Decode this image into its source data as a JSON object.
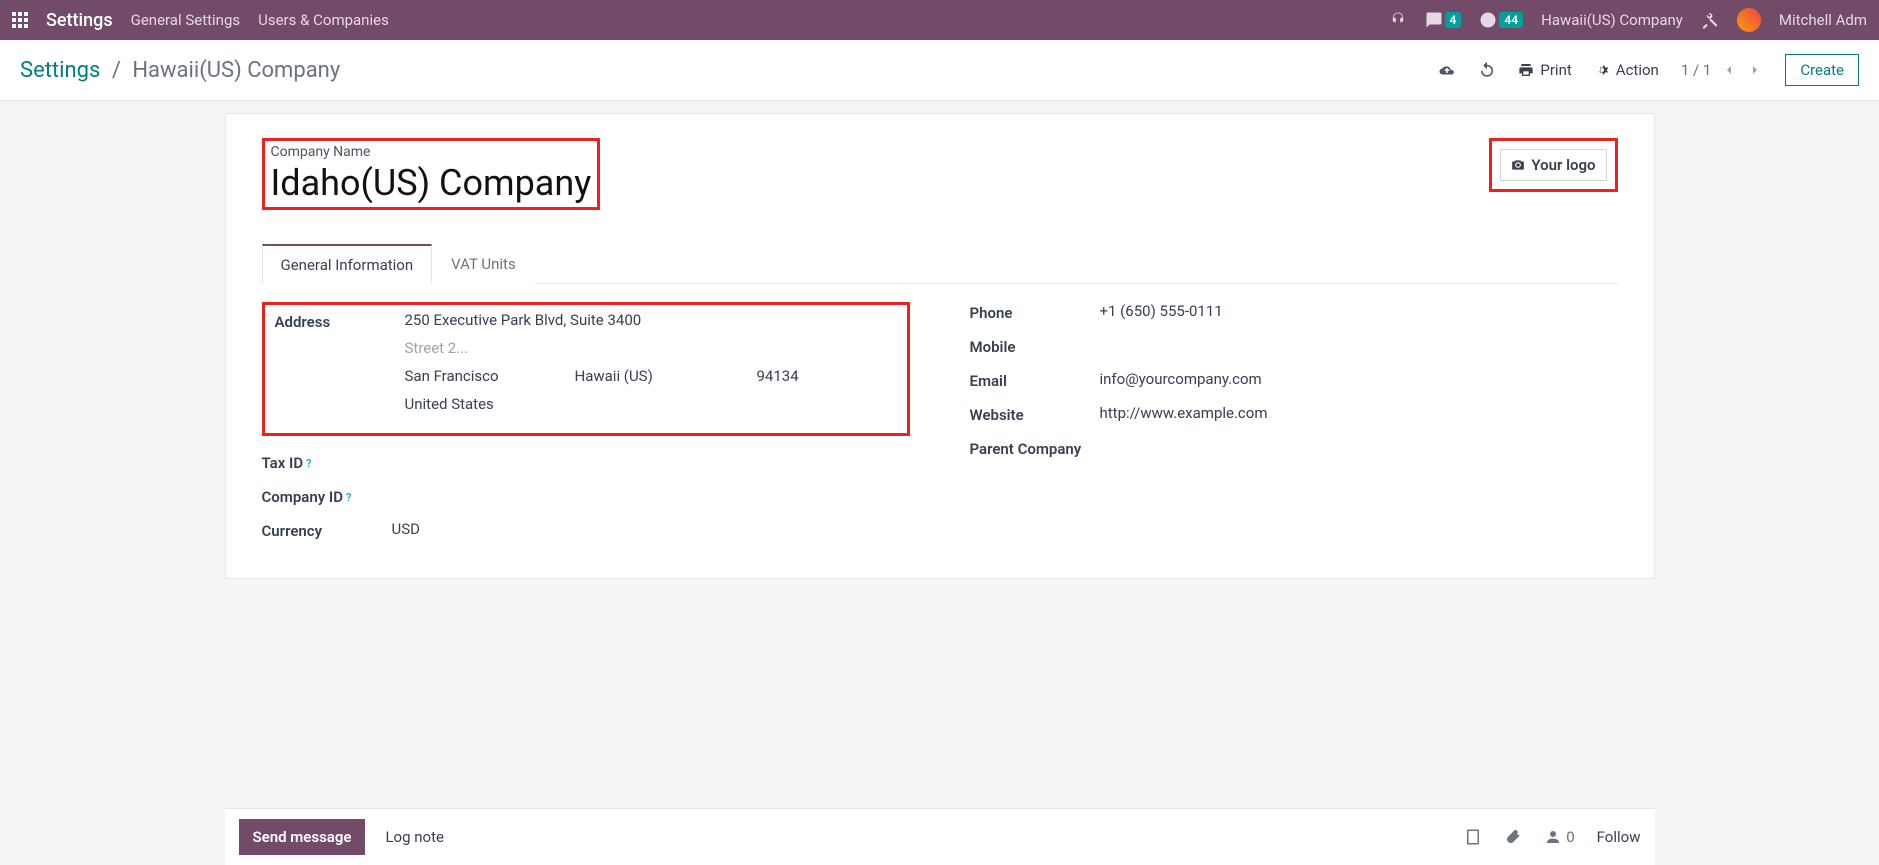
{
  "navbar": {
    "app_title": "Settings",
    "links": [
      "General Settings",
      "Users & Companies"
    ],
    "messages_count": "4",
    "activities_count": "44",
    "company": "Hawaii(US) Company",
    "user": "Mitchell Adm"
  },
  "controlbar": {
    "breadcrumb_root": "Settings",
    "breadcrumb_current": "Hawaii(US) Company",
    "print_label": "Print",
    "action_label": "Action",
    "pager": "1 / 1",
    "create_label": "Create"
  },
  "form": {
    "company_name_label": "Company Name",
    "company_name_value": "Idaho(US) Company",
    "logo_placeholder": "Your logo",
    "tabs": [
      "General Information",
      "VAT Units"
    ],
    "left": {
      "address_label": "Address",
      "street": "250 Executive Park Blvd, Suite 3400",
      "street2_placeholder": "Street 2...",
      "city": "San Francisco",
      "state": "Hawaii (US)",
      "zip": "94134",
      "country": "United States",
      "tax_id_label": "Tax ID",
      "company_id_label": "Company ID",
      "currency_label": "Currency",
      "currency_value": "USD"
    },
    "right": {
      "phone_label": "Phone",
      "phone_value": "+1 (650) 555-0111",
      "mobile_label": "Mobile",
      "email_label": "Email",
      "email_value": "info@yourcompany.com",
      "website_label": "Website",
      "website_value": "http://www.example.com",
      "parent_label": "Parent Company"
    }
  },
  "chatter": {
    "send_label": "Send message",
    "log_label": "Log note",
    "followers": "0",
    "follow_label": "Follow"
  }
}
